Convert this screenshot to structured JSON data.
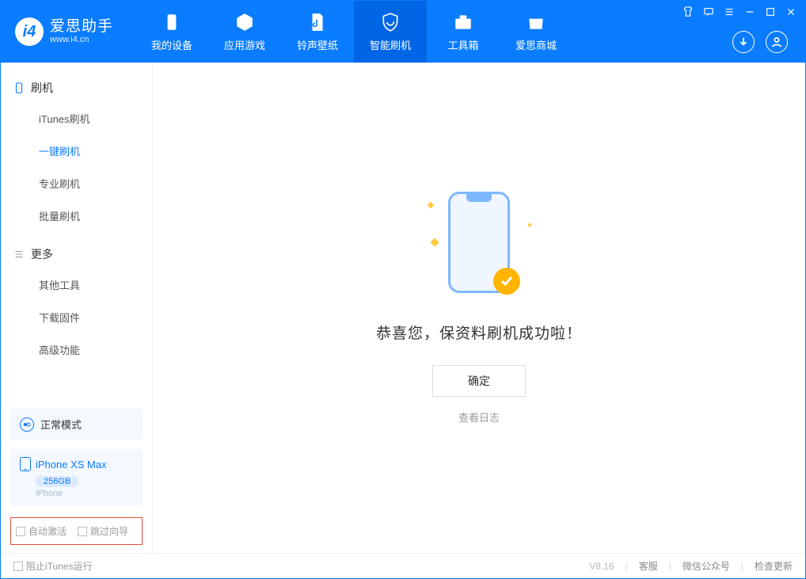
{
  "app": {
    "title": "爱思助手",
    "subtitle": "www.i4.cn"
  },
  "tabs": [
    {
      "label": "我的设备"
    },
    {
      "label": "应用游戏"
    },
    {
      "label": "铃声壁纸"
    },
    {
      "label": "智能刷机"
    },
    {
      "label": "工具箱"
    },
    {
      "label": "爱思商城"
    }
  ],
  "sidebar": {
    "section1": {
      "title": "刷机"
    },
    "items1": [
      {
        "label": "iTunes刷机"
      },
      {
        "label": "一键刷机"
      },
      {
        "label": "专业刷机"
      },
      {
        "label": "批量刷机"
      }
    ],
    "section2": {
      "title": "更多"
    },
    "items2": [
      {
        "label": "其他工具"
      },
      {
        "label": "下载固件"
      },
      {
        "label": "高级功能"
      }
    ],
    "mode": "正常模式",
    "device": {
      "name": "iPhone XS Max",
      "capacity": "256GB",
      "type": "iPhone"
    },
    "options": {
      "auto_activate": "自动激活",
      "skip_guide": "跳过向导"
    }
  },
  "main": {
    "success_message": "恭喜您，保资料刷机成功啦！",
    "ok_button": "确定",
    "view_log": "查看日志"
  },
  "footer": {
    "block_itunes": "阻止iTunes运行",
    "version": "V8.16",
    "customer_service": "客服",
    "wechat": "微信公众号",
    "check_update": "检查更新"
  }
}
